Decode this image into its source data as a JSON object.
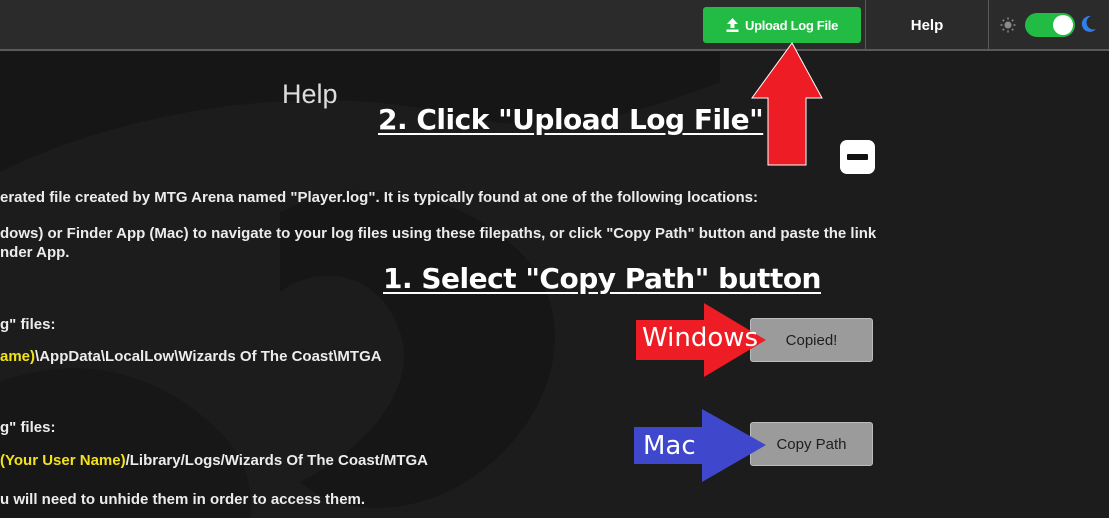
{
  "topbar": {
    "upload_label": "Upload Log File",
    "help_label": "Help",
    "theme": {
      "mode": "dark",
      "toggle_on": true
    }
  },
  "content": {
    "title": "Help",
    "line1": "erated file created by MTG Arena named \"Player.log\". It is typically found at one of the following locations:",
    "line2": "dows) or Finder App (Mac) to navigate to your log files using these filepaths, or click \"Copy Path\" button and paste the link",
    "line3": "nder App.",
    "windows_heading": "g\" files:",
    "windows_path_user": "ame)",
    "windows_path_rest": "\\AppData\\LocalLow\\Wizards Of The Coast\\MTGA",
    "mac_heading": "g\" files:",
    "mac_path_user": "(Your User Name)",
    "mac_path_rest": "/Library/Logs/Wizards Of The Coast/MTGA",
    "footer_line": "u will need to unhide them in order to access them.",
    "windows_button": "Copied!",
    "mac_button": "Copy Path"
  },
  "annotations": {
    "step2": "2. Click \"Upload Log File\"",
    "step1": "1. Select \"Copy Path\" button",
    "windows_label": "Windows",
    "mac_label": "Mac"
  },
  "colors": {
    "accent_green": "#22bb44",
    "arrow_red": "#ee1c24",
    "arrow_blue": "#3f48cc",
    "path_highlight": "#f2e21c"
  }
}
